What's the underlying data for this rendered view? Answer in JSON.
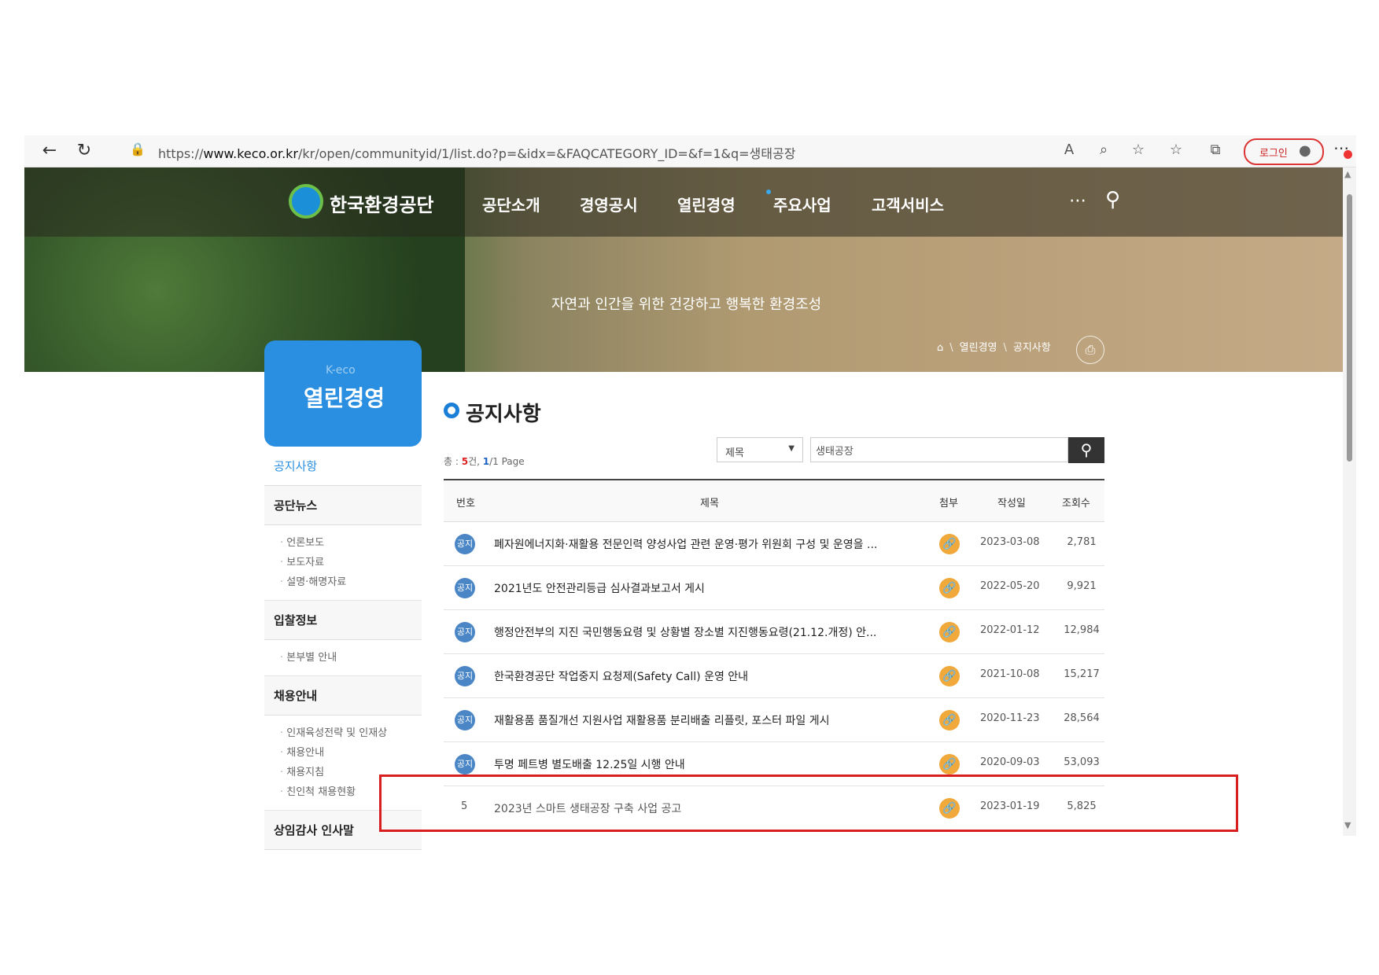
{
  "browser": {
    "url_prefix": "https://",
    "url_domain": "www.keco.or.kr",
    "url_path": "/kr/open/communityid/1/list.do?p=&idx=&FAQCATEGORY_ID=&f=1&q=생태공장",
    "login_label": "로그인"
  },
  "site": {
    "logo_text": "한국환경공단",
    "nav": [
      "공단소개",
      "경영공시",
      "열린경영",
      "주요사업",
      "고객서비스"
    ],
    "slogan": "자연과 인간을 위한 건강하고 행복한 환경조성",
    "breadcrumb": [
      "열린경영",
      "공지사항"
    ]
  },
  "sidebar": {
    "brand_sub": "K-eco",
    "title": "열린경영",
    "active": "공지사항",
    "groups": [
      {
        "label": "공단뉴스",
        "items": [
          "언론보도",
          "보도자료",
          "설명·해명자료"
        ]
      },
      {
        "label": "입찰정보",
        "items": [
          "본부별 안내"
        ]
      },
      {
        "label": "채용안내",
        "items": [
          "인재육성전략 및 인재상",
          "채용안내",
          "채용지침",
          "친인척 채용현황"
        ]
      },
      {
        "label": "상임감사 인사말",
        "items": []
      }
    ]
  },
  "main": {
    "title": "공지사항",
    "count_prefix": "총 : ",
    "count": "5",
    "count_mid": "건, ",
    "page": "1",
    "page_suffix": "/1 Page",
    "search_field": "제목",
    "search_value": "생태공장",
    "columns": [
      "번호",
      "제목",
      "첨부",
      "작성일",
      "조회수"
    ],
    "notice_badge": "공지",
    "rows": [
      {
        "num": "",
        "notice": true,
        "title": "폐자원에너지화·재활용 전문인력 양성사업 관련 운영·평가 위원회 구성 및 운영을 ...",
        "date": "2023-03-08",
        "views": "2,781"
      },
      {
        "num": "",
        "notice": true,
        "title": "2021년도 안전관리등급 심사결과보고서 게시",
        "date": "2022-05-20",
        "views": "9,921"
      },
      {
        "num": "",
        "notice": true,
        "title": "행정안전부의 지진 국민행동요령 및 상황별 장소별 지진행동요령(21.12.개정) 안...",
        "date": "2022-01-12",
        "views": "12,984"
      },
      {
        "num": "",
        "notice": true,
        "title": "한국환경공단 작업중지 요청제(Safety Call) 운영 안내",
        "date": "2021-10-08",
        "views": "15,217"
      },
      {
        "num": "",
        "notice": true,
        "title": "재활용품 품질개선 지원사업 재활용품 분리배출 리플릿, 포스터 파일 게시",
        "date": "2020-11-23",
        "views": "28,564"
      },
      {
        "num": "",
        "notice": true,
        "title": "투명 페트병 별도배출 12.25일 시행 안내",
        "date": "2020-09-03",
        "views": "53,093"
      },
      {
        "num": "5",
        "notice": false,
        "title": "2023년 스마트 생태공장 구축 사업 공고",
        "date": "2023-01-19",
        "views": "5,825"
      }
    ]
  },
  "colors": {
    "brand_blue": "#2a8fe0",
    "attach_orange": "#f0a93a",
    "highlight_red": "#d81e1e"
  }
}
